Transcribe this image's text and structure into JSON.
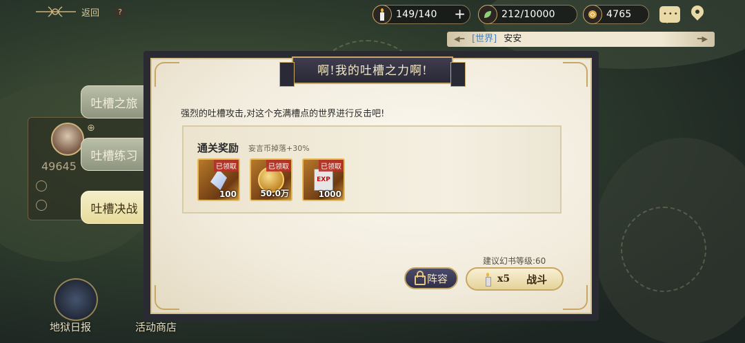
{
  "top_bar": {
    "back_label": "返回",
    "help_label": "?",
    "resources": [
      {
        "icon": "candle-icon",
        "value": "149/140"
      },
      {
        "icon": "leaf-icon",
        "value": "212/10000"
      },
      {
        "icon": "coin-swirl-icon",
        "value": "4765"
      }
    ],
    "plus_label": "+"
  },
  "world_chat": {
    "channel": "[世界]",
    "message": "安安"
  },
  "side_panel": {
    "score": "49645",
    "tabs": [
      "吐槽之旅",
      "吐槽练习",
      "吐槽决战"
    ],
    "active_tab": "吐槽决战"
  },
  "bottom_nav": [
    "地狱日报",
    "活动商店"
  ],
  "dialog": {
    "title": "啊!我的吐槽之力啊!",
    "description": "强烈的吐槽攻击,对这个充满槽点的世界进行反击吧!",
    "reward_title": "通关奖励",
    "reward_bonus": "妄言币掉落+30%",
    "rewards": [
      {
        "name": "crystal",
        "status": "已领取",
        "amount": "100"
      },
      {
        "name": "coin",
        "status": "已领取",
        "amount": "50.0万"
      },
      {
        "name": "exp-card",
        "status": "已领取",
        "amount": "1000"
      }
    ],
    "exp_card_text": "EXP",
    "recommended_level": "建议幻书等级:60",
    "team_button": "阵容",
    "fight_cost": "x5",
    "fight_button": "战斗"
  }
}
